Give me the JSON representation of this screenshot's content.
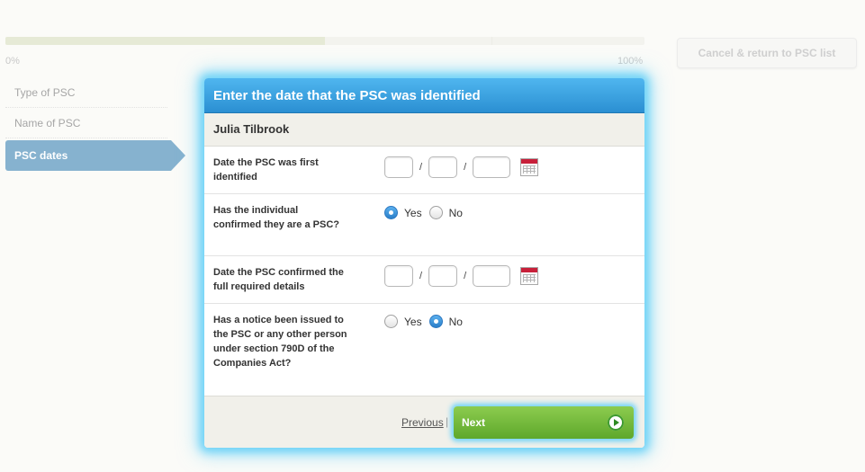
{
  "progress": {
    "min_label": "0%",
    "max_label": "100%",
    "value": 0.5
  },
  "header": {
    "cancel_label": "Cancel & return to PSC list"
  },
  "sidebar": {
    "items": [
      {
        "label": "Type of PSC",
        "active": false
      },
      {
        "label": "Name of PSC",
        "active": false
      },
      {
        "label": "PSC dates",
        "active": true
      }
    ]
  },
  "modal": {
    "title": "Enter the date that the PSC was identified",
    "subject": "Julia Tilbrook",
    "rows": [
      {
        "label": "Date the PSC was first identified",
        "type": "date",
        "date_separator": "/",
        "day": "",
        "month": "",
        "year": ""
      },
      {
        "label": "Has the individual confirmed they are a PSC?",
        "type": "radio",
        "options": [
          "Yes",
          "No"
        ],
        "selected": "Yes"
      },
      {
        "label": "Date the PSC confirmed the full required details",
        "type": "date",
        "date_separator": "/",
        "day": "",
        "month": "",
        "year": ""
      },
      {
        "label": "Has a notice been issued to the PSC or any other person under section 790D of the Companies Act?",
        "type": "radio",
        "options": [
          "Yes",
          "No"
        ],
        "selected": "No"
      }
    ],
    "footer": {
      "previous_label": "Previous",
      "separator": "|",
      "next_label": "Next"
    }
  },
  "colors": {
    "header_blue": "#2b8fd2",
    "glow": "#6fd3f7",
    "next_green": "#6cb535",
    "active_nav": "#86b2cf"
  },
  "icons": {
    "calendar": "calendar-icon",
    "next_arrow": "arrow-right-circle-icon"
  }
}
